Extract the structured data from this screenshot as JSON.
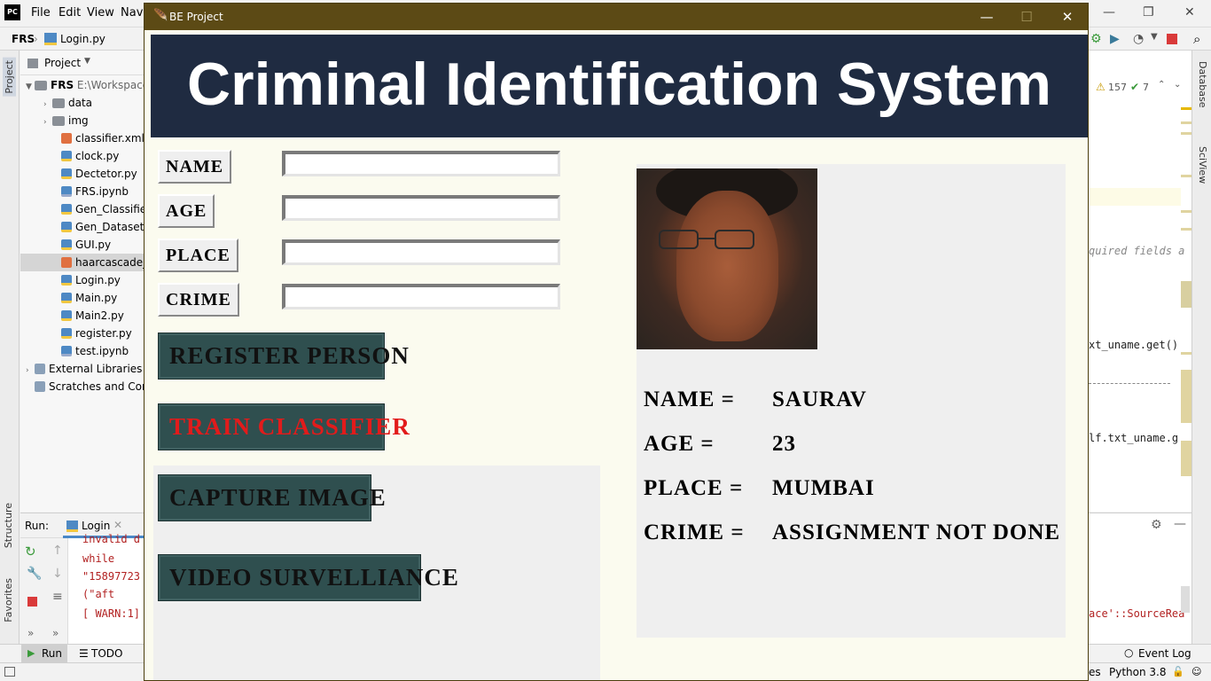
{
  "ide": {
    "logo": "PC",
    "menu": [
      "File",
      "Edit",
      "View",
      "Navi"
    ],
    "breadcrumb": {
      "project": "FRS",
      "file": "Login.py"
    },
    "project_panel_title": "Project",
    "project_root": "FRS",
    "project_path": "E:\\Workspace",
    "tree": [
      {
        "label": "data",
        "type": "folder"
      },
      {
        "label": "img",
        "type": "folder"
      },
      {
        "label": "classifier.xml",
        "type": "xml"
      },
      {
        "label": "clock.py",
        "type": "py"
      },
      {
        "label": "Dectetor.py",
        "type": "py"
      },
      {
        "label": "FRS.ipynb",
        "type": "nb"
      },
      {
        "label": "Gen_Classifier.p",
        "type": "py"
      },
      {
        "label": "Gen_Dataset.py",
        "type": "py"
      },
      {
        "label": "GUI.py",
        "type": "py"
      },
      {
        "label": "haarcascade_fr",
        "type": "xml"
      },
      {
        "label": "Login.py",
        "type": "py"
      },
      {
        "label": "Main.py",
        "type": "py"
      },
      {
        "label": "Main2.py",
        "type": "py"
      },
      {
        "label": "register.py",
        "type": "py"
      },
      {
        "label": "test.ipynb",
        "type": "nb"
      },
      {
        "label": "External Libraries",
        "type": "lib"
      },
      {
        "label": "Scratches and Cor",
        "type": "lib"
      }
    ],
    "side_tabs": {
      "project": "Project",
      "structure": "Structure",
      "favorites": "Favorites",
      "database": "Database",
      "sciview": "SciView"
    },
    "run_label": "Run:",
    "run_tab": "Login",
    "console": [
      "invalid d",
      "   while",
      "\"15897723",
      "   (\"aft",
      "[ WARN:1]"
    ],
    "editor": {
      "warnings": "157",
      "checks": "7",
      "fragments": [
        "quired fields a",
        "xt_uname.get()",
        "lf.txt_uname.g",
        "ace'::SourceRea"
      ]
    },
    "bottom_tabs": {
      "run": "Run",
      "todo": "TODO",
      "event_log": "Event Log"
    },
    "status": {
      "python": "Python 3.8",
      "left_fragment": "es"
    }
  },
  "app": {
    "window_title": "BE Project",
    "banner_title": "Criminal Identification System",
    "form": {
      "name_label": "NAME",
      "age_label": "AGE",
      "place_label": "PLACE",
      "crime_label": "CRIME",
      "name_value": "",
      "age_value": "",
      "place_value": "",
      "crime_value": ""
    },
    "buttons": {
      "register": "REGISTER PERSON",
      "train": "TRAIN CLASSIFIER",
      "capture": "CAPTURE  IMAGE",
      "video": "VIDEO SURVELLIANCE"
    },
    "details": {
      "name_label": "NAME =",
      "name_value": "SAURAV",
      "age_label": "AGE =",
      "age_value": "23",
      "place_label": "PLACE =",
      "place_value": "MUMBAI",
      "crime_label": "CRIME =",
      "crime_value": "ASSIGNMENT NOT DONE"
    }
  },
  "colors": {
    "banner_bg": "#1f2b41",
    "button_bg": "#2f4f4f",
    "train_text": "#e21b1b",
    "window_bg": "#fbfbef",
    "titlebar": "#5c4a15"
  }
}
